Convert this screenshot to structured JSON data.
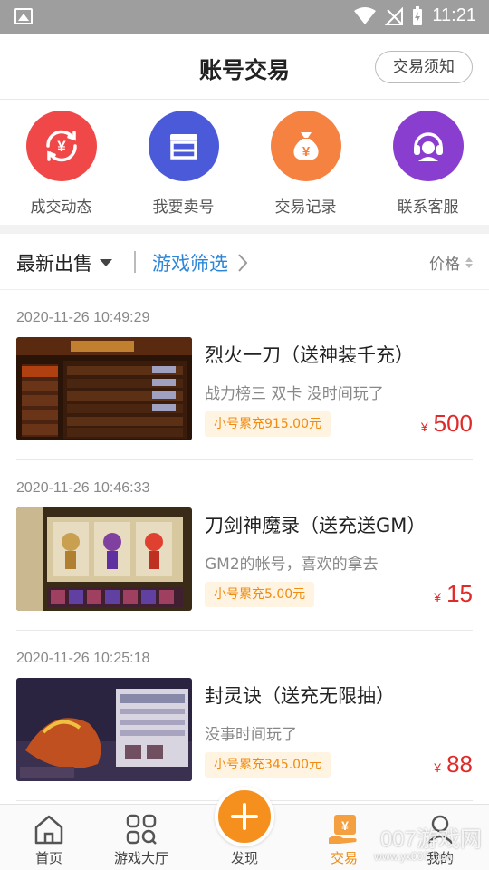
{
  "status_bar": {
    "time": "11:21"
  },
  "header": {
    "title": "账号交易",
    "notice_button": "交易须知"
  },
  "quick_actions": [
    {
      "label": "成交动态",
      "icon": "yen-refresh-icon",
      "color": "#f04848"
    },
    {
      "label": "我要卖号",
      "icon": "shop-icon",
      "color": "#4a5ad8"
    },
    {
      "label": "交易记录",
      "icon": "money-bag-icon",
      "color": "#f58240"
    },
    {
      "label": "联系客服",
      "icon": "headset-icon",
      "color": "#8a3ed0"
    }
  ],
  "filters": {
    "latest": "最新出售",
    "game_filter": "游戏筛选",
    "price": "价格"
  },
  "listings": [
    {
      "time": "2020-11-26 10:49:29",
      "title": "烈火一刀（送神装千充）",
      "desc": "战力榜三 双卡 没时间玩了",
      "badge": "小号累充915.00元",
      "currency": "¥",
      "price": "500"
    },
    {
      "time": "2020-11-26 10:46:33",
      "title": "刀剑神魔录（送充送GM）",
      "desc": "GM2的帐号，喜欢的拿去",
      "badge": "小号累充5.00元",
      "currency": "¥",
      "price": "15"
    },
    {
      "time": "2020-11-26 10:25:18",
      "title": "封灵诀（送充无限抽）",
      "desc": "没事时间玩了",
      "badge": "小号累充345.00元",
      "currency": "¥",
      "price": "88"
    }
  ],
  "tabs": [
    {
      "label": "首页",
      "icon": "home-icon"
    },
    {
      "label": "游戏大厅",
      "icon": "grid-icon"
    },
    {
      "label": "发现",
      "icon": "plus-icon"
    },
    {
      "label": "交易",
      "icon": "trade-icon",
      "active": true
    },
    {
      "label": "我的",
      "icon": "user-icon"
    }
  ],
  "watermark": {
    "text": "007游戏网",
    "url": "www.yx007.com"
  },
  "colors": {
    "accent": "#f5901e",
    "link": "#2c86d8",
    "price": "#e02a2a",
    "badge_text": "#f08c10",
    "badge_bg": "#fff3e2"
  }
}
